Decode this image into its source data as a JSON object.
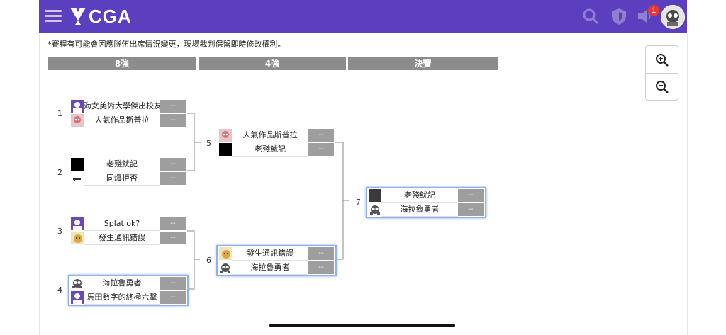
{
  "header": {
    "logo_text": "CGA",
    "notification_count": "1",
    "brand_color": "#5b3fbf",
    "icons": [
      "menu-icon",
      "search-icon",
      "shield-icon",
      "speaker-icon",
      "avatar"
    ]
  },
  "notice": "*賽程有可能會因應隊伍出席情況變更，現場裁判保留即時修改權利。",
  "rounds": [
    "8強",
    "4強",
    "決賽"
  ],
  "zoom": {
    "in_icon": "zoom-in-icon",
    "out_icon": "zoom-out-icon"
  },
  "matches": [
    {
      "number": "1",
      "players": [
        {
          "name": "海女美術大學傑出校友",
          "score": "--"
        },
        {
          "name": "人氣作品斯普拉",
          "score": "--"
        }
      ]
    },
    {
      "number": "2",
      "players": [
        {
          "name": "老殘魷記",
          "score": "--"
        },
        {
          "name": "同爆拒否",
          "score": "--"
        }
      ]
    },
    {
      "number": "3",
      "players": [
        {
          "name": "Splat ok?",
          "score": "--"
        },
        {
          "name": "發生通訊錯誤",
          "score": "--"
        }
      ]
    },
    {
      "number": "4",
      "players": [
        {
          "name": "海拉魯勇者",
          "score": "--"
        },
        {
          "name": "馬田數字的終極六擊",
          "score": "--"
        }
      ]
    },
    {
      "number": "5",
      "players": [
        {
          "name": "人氣作品斯普拉",
          "score": "--"
        },
        {
          "name": "老殘魷記",
          "score": "--"
        }
      ]
    },
    {
      "number": "6",
      "players": [
        {
          "name": "發生通訊錯誤",
          "score": "--"
        },
        {
          "name": "海拉魯勇者",
          "score": "--"
        }
      ]
    },
    {
      "number": "7",
      "players": [
        {
          "name": "老殘魷記",
          "score": "--"
        },
        {
          "name": "海拉魯勇者",
          "score": "--"
        }
      ]
    }
  ]
}
